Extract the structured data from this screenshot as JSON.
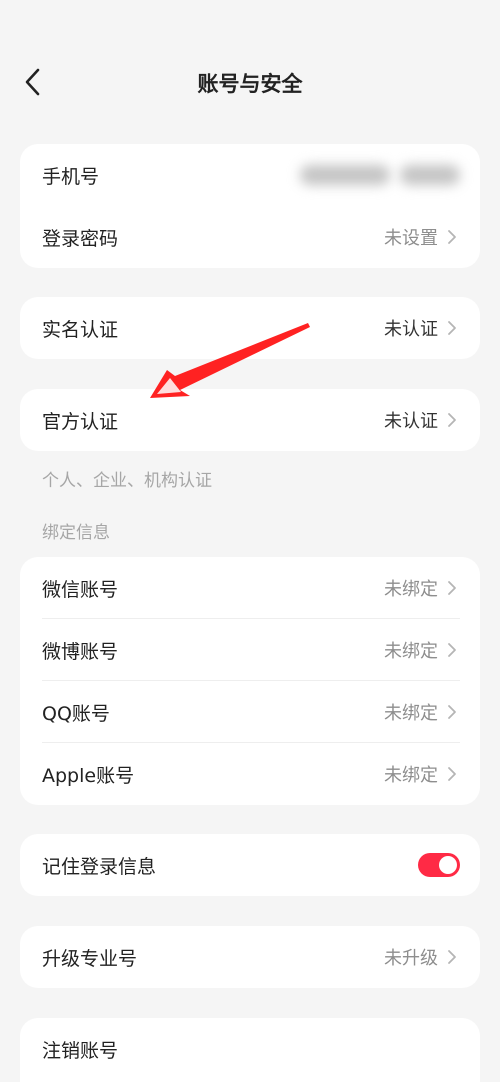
{
  "header": {
    "title": "账号与安全"
  },
  "account": {
    "phone_label": "手机号",
    "password_label": "登录密码",
    "password_value": "未设置"
  },
  "realname": {
    "label": "实名认证",
    "value": "未认证"
  },
  "official": {
    "label": "官方认证",
    "value": "未认证",
    "note": "个人、企业、机构认证"
  },
  "bindings": {
    "section_title": "绑定信息",
    "items": [
      {
        "label": "微信账号",
        "value": "未绑定"
      },
      {
        "label": "微博账号",
        "value": "未绑定"
      },
      {
        "label": "QQ账号",
        "value": "未绑定"
      },
      {
        "label": "Apple账号",
        "value": "未绑定"
      }
    ]
  },
  "remember": {
    "label": "记住登录信息",
    "enabled": true,
    "accent": "#ff2a45"
  },
  "upgrade": {
    "label": "升级专业号",
    "value": "未升级"
  },
  "cancel": {
    "label": "注销账号"
  },
  "icons": {
    "back": "chevron-left-icon",
    "row_arrow": "chevron-right-icon",
    "annotation": "red-arrow-icon"
  }
}
